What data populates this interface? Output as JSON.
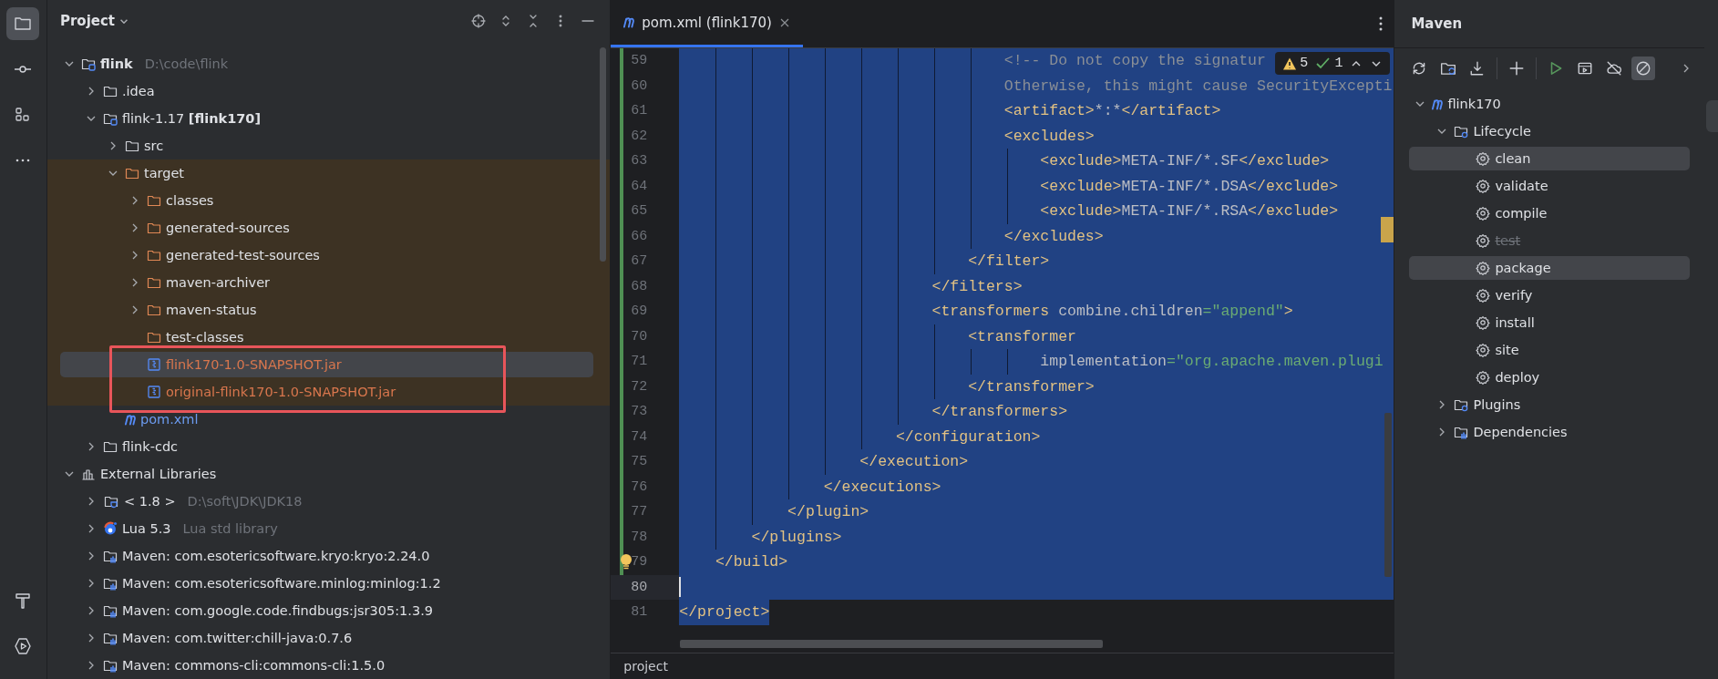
{
  "tool_strip": {
    "top": [
      {
        "kind": "folder",
        "selected": true
      },
      {
        "kind": "commit",
        "selected": false
      },
      {
        "kind": "structure",
        "selected": false
      },
      {
        "kind": "more",
        "selected": false
      }
    ],
    "bottom": [
      {
        "kind": "build",
        "selected": false
      },
      {
        "kind": "run",
        "selected": false
      }
    ]
  },
  "project": {
    "title": "Project",
    "tree": [
      {
        "label": "flink",
        "hint": "D:\\code\\flink",
        "kind": "project",
        "expanded": true,
        "children": [
          {
            "label": ".idea",
            "kind": "folder",
            "expanded": false
          },
          {
            "label": "flink-1.17 **[flink170]**",
            "kind": "module",
            "expanded": true,
            "children": [
              {
                "label": "src",
                "kind": "folder",
                "expanded": false
              },
              {
                "label": "target",
                "kind": "excluded",
                "expanded": true,
                "excluded": true,
                "children": [
                  {
                    "label": "classes",
                    "kind": "excluded",
                    "expanded": false,
                    "excluded": true
                  },
                  {
                    "label": "generated-sources",
                    "kind": "excluded",
                    "expanded": false,
                    "excluded": true
                  },
                  {
                    "label": "generated-test-sources",
                    "kind": "excluded",
                    "expanded": false,
                    "excluded": true
                  },
                  {
                    "label": "maven-archiver",
                    "kind": "excluded",
                    "expanded": false,
                    "excluded": true
                  },
                  {
                    "label": "maven-status",
                    "kind": "excluded",
                    "expanded": false,
                    "excluded": true
                  },
                  {
                    "label": "test-classes",
                    "kind": "excluded",
                    "excluded": true
                  },
                  {
                    "label": "flink170-1.0-SNAPSHOT.jar",
                    "kind": "jar",
                    "excluded": true,
                    "selected": true,
                    "color": "#d8764d",
                    "marked": true
                  },
                  {
                    "label": "original-flink170-1.0-SNAPSHOT.jar",
                    "kind": "jar",
                    "excluded": true,
                    "color": "#d8764d",
                    "marked": true
                  }
                ]
              },
              {
                "label": "pom.xml",
                "kind": "maven",
                "color": "#6c9bf0"
              }
            ]
          },
          {
            "label": "flink-cdc",
            "kind": "folder",
            "expanded": false
          }
        ]
      },
      {
        "label": "External Libraries",
        "kind": "libraries",
        "expanded": true,
        "children": [
          {
            "label": "< 1.8 >",
            "hint": "D:\\soft\\JDK\\JDK18",
            "kind": "sdk",
            "expanded": false
          },
          {
            "label": "Lua 5.3",
            "hint": "Lua std library",
            "kind": "lua",
            "expanded": false
          },
          {
            "label": "Maven: com.esotericsoftware.kryo:kryo:2.24.0",
            "kind": "library",
            "expanded": false
          },
          {
            "label": "Maven: com.esotericsoftware.minlog:minlog:1.2",
            "kind": "library",
            "expanded": false
          },
          {
            "label": "Maven: com.google.code.findbugs:jsr305:1.3.9",
            "kind": "library",
            "expanded": false
          },
          {
            "label": "Maven: com.twitter:chill-java:0.7.6",
            "kind": "library",
            "expanded": false
          },
          {
            "label": "Maven: commons-cli:commons-cli:1.5.0",
            "kind": "library",
            "expanded": false
          }
        ]
      }
    ]
  },
  "editor": {
    "tabs": [
      {
        "label": "pom.xml (flink170)",
        "selected": true
      }
    ],
    "inspections": {
      "warnings": "5",
      "passed": "1"
    },
    "lines": [
      {
        "number": "59",
        "changed": true,
        "selected": true,
        "tokens": [
          {
            "kind": "comment",
            "text": "                                    <!-- Do not copy the signatur"
          }
        ]
      },
      {
        "number": "60",
        "changed": true,
        "selected": true,
        "tokens": [
          {
            "kind": "comment",
            "text": "                                    Otherwise, this might cause SecurityExcepti"
          }
        ]
      },
      {
        "number": "61",
        "changed": true,
        "selected": true,
        "tokens": [
          {
            "kind": "tag",
            "text": "                                    <artifact>"
          },
          {
            "kind": "text",
            "text": "*:*"
          },
          {
            "kind": "tag",
            "text": "</artifact>"
          }
        ]
      },
      {
        "number": "62",
        "changed": true,
        "selected": true,
        "tokens": [
          {
            "kind": "tag",
            "text": "                                    <excludes>"
          }
        ]
      },
      {
        "number": "63",
        "changed": true,
        "selected": true,
        "tokens": [
          {
            "kind": "tag",
            "text": "                                        <exclude>"
          },
          {
            "kind": "text",
            "text": "META-INF/*.SF"
          },
          {
            "kind": "tag",
            "text": "</exclude>"
          }
        ]
      },
      {
        "number": "64",
        "changed": true,
        "selected": true,
        "tokens": [
          {
            "kind": "tag",
            "text": "                                        <exclude>"
          },
          {
            "kind": "text",
            "text": "META-INF/*.DSA"
          },
          {
            "kind": "tag",
            "text": "</exclude>"
          }
        ]
      },
      {
        "number": "65",
        "changed": true,
        "selected": true,
        "tokens": [
          {
            "kind": "tag",
            "text": "                                        <exclude>"
          },
          {
            "kind": "text",
            "text": "META-INF/*.RSA"
          },
          {
            "kind": "tag",
            "text": "</exclude>"
          }
        ]
      },
      {
        "number": "66",
        "changed": true,
        "selected": true,
        "tokens": [
          {
            "kind": "tag",
            "text": "                                    </excludes>"
          }
        ]
      },
      {
        "number": "67",
        "changed": true,
        "selected": true,
        "tokens": [
          {
            "kind": "tag",
            "text": "                                </filter>"
          }
        ]
      },
      {
        "number": "68",
        "changed": true,
        "selected": true,
        "tokens": [
          {
            "kind": "tag",
            "text": "                            </filters>"
          }
        ]
      },
      {
        "number": "69",
        "changed": true,
        "selected": true,
        "tokens": [
          {
            "kind": "tag",
            "text": "                            <transformers "
          },
          {
            "kind": "attr",
            "text": "combine.children"
          },
          {
            "kind": "string",
            "text": "=\"append\""
          },
          {
            "kind": "tag",
            "text": ">"
          }
        ]
      },
      {
        "number": "70",
        "changed": true,
        "selected": true,
        "tokens": [
          {
            "kind": "tag",
            "text": "                                <transformer"
          }
        ]
      },
      {
        "number": "71",
        "changed": true,
        "selected": true,
        "tokens": [
          {
            "kind": "attr",
            "text": "                                        implementation"
          },
          {
            "kind": "string",
            "text": "=\"org.apache.maven.plugi"
          }
        ]
      },
      {
        "number": "72",
        "changed": true,
        "selected": true,
        "tokens": [
          {
            "kind": "tag",
            "text": "                                </transformer>"
          }
        ]
      },
      {
        "number": "73",
        "changed": true,
        "selected": true,
        "tokens": [
          {
            "kind": "tag",
            "text": "                            </transformers>"
          }
        ]
      },
      {
        "number": "74",
        "changed": true,
        "selected": true,
        "tokens": [
          {
            "kind": "tag",
            "text": "                        </configuration>"
          }
        ]
      },
      {
        "number": "75",
        "changed": true,
        "selected": true,
        "tokens": [
          {
            "kind": "tag",
            "text": "                    </execution>"
          }
        ]
      },
      {
        "number": "76",
        "changed": true,
        "selected": true,
        "tokens": [
          {
            "kind": "tag",
            "text": "                </executions>"
          }
        ]
      },
      {
        "number": "77",
        "changed": true,
        "selected": true,
        "tokens": [
          {
            "kind": "tag",
            "text": "            </plugin>"
          }
        ]
      },
      {
        "number": "78",
        "changed": true,
        "selected": true,
        "tokens": [
          {
            "kind": "tag",
            "text": "        </plugins>"
          }
        ]
      },
      {
        "number": "79",
        "changed": true,
        "selected": true,
        "bulb": true,
        "tokens": [
          {
            "kind": "tag",
            "text": "    </build>"
          }
        ]
      },
      {
        "number": "80",
        "changed": false,
        "selected": true,
        "current": true
      },
      {
        "number": "81",
        "changed": false,
        "selected": true,
        "tokens": [
          {
            "kind": "tag",
            "text": "</project>"
          }
        ]
      }
    ],
    "breadcrumb": "project"
  },
  "maven": {
    "title": "Maven",
    "toolbar": [
      {
        "kind": "reload",
        "on": false
      },
      {
        "kind": "folder-sync",
        "on": false
      },
      {
        "kind": "download",
        "on": false
      },
      {
        "kind": "plus",
        "on": false
      },
      {
        "kind": "run",
        "on": false
      },
      {
        "kind": "window",
        "on": false
      },
      {
        "kind": "offline",
        "on": false
      },
      {
        "kind": "skip",
        "on": true
      }
    ],
    "tree": [
      {
        "label": "flink170",
        "kind": "maven",
        "expanded": true,
        "children": [
          {
            "label": "Lifecycle",
            "kind": "lifecycle",
            "expanded": true,
            "children": [
              {
                "label": "clean",
                "kind": "gear",
                "selected": true,
                "skipped": false
              },
              {
                "label": "validate",
                "kind": "gear",
                "selected": false,
                "skipped": false
              },
              {
                "label": "compile",
                "kind": "gear",
                "selected": false,
                "skipped": false
              },
              {
                "label": "test",
                "kind": "gear",
                "selected": false,
                "skipped": true
              },
              {
                "label": "package",
                "kind": "gear",
                "selected": true,
                "skipped": false
              },
              {
                "label": "verify",
                "kind": "gear",
                "selected": false,
                "skipped": false
              },
              {
                "label": "install",
                "kind": "gear",
                "selected": false,
                "skipped": false
              },
              {
                "label": "site",
                "kind": "gear",
                "selected": false,
                "skipped": false
              },
              {
                "label": "deploy",
                "kind": "gear",
                "selected": false,
                "skipped": false
              }
            ]
          },
          {
            "label": "Plugins",
            "kind": "lifecycle",
            "expanded": false
          },
          {
            "label": "Dependencies",
            "kind": "deps",
            "expanded": false
          }
        ]
      }
    ]
  }
}
